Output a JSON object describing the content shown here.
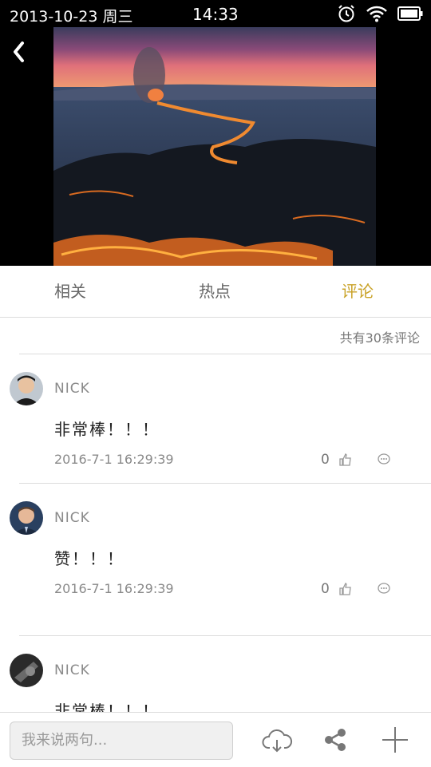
{
  "status_bar": {
    "date": "2013-10-23 周三",
    "time": "14:33"
  },
  "hero": {
    "image_description_icon": "volcano-photo"
  },
  "tabs": [
    {
      "label": "相关",
      "active": false
    },
    {
      "label": "热点",
      "active": false
    },
    {
      "label": "评论",
      "active": true
    }
  ],
  "comments_header": {
    "count_text": "共有30条评论"
  },
  "comments": [
    {
      "user": "NICK",
      "text": "非常棒！！！",
      "time": "2016-7-1 16:29:39",
      "likes": "0"
    },
    {
      "user": "NICK",
      "text": "赞！！！",
      "time": "2016-7-1 16:29:39",
      "likes": "0"
    },
    {
      "user": "NICK",
      "text": "非常棒！！！",
      "time": "",
      "likes": ""
    }
  ],
  "bottom_bar": {
    "input_placeholder": "我来说两句..."
  },
  "colors": {
    "accent": "#c9a227",
    "text_muted": "#8a8a8a",
    "divider": "#dcdcdc"
  }
}
